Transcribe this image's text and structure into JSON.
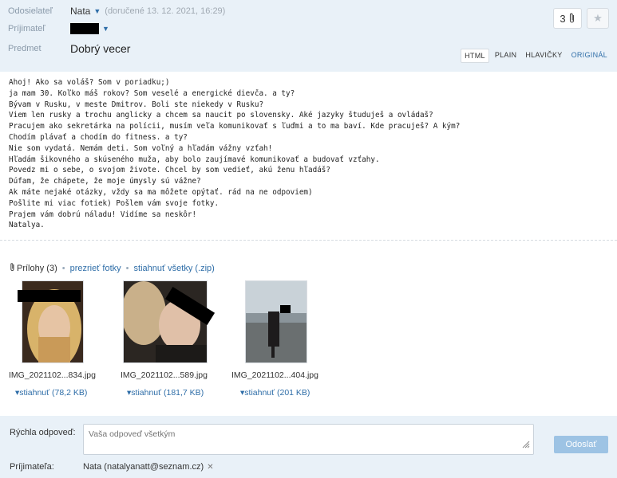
{
  "header": {
    "sender_label": "Odosielateľ",
    "sender_name": "Nata",
    "delivered": "(doručené 13. 12. 2021, 16:29)",
    "recipient_label": "Príjimateľ",
    "subject_label": "Predmet",
    "subject": "Dobrý vecer",
    "attachment_count": "3",
    "view_tabs": [
      "HTML",
      "PLAIN",
      "HLAVIČKY",
      "ORIGINÁL"
    ]
  },
  "message": {
    "body": "Ahoj! Ako sa voláš? Som v poriadku;)\nja mam 30. Koľko máš rokov? Som veselé a energické dievča. a ty?\nBývam v Rusku, v meste Dmitrov. Boli ste niekedy v Rusku?\nViem len rusky a trochu anglicky a chcem sa naucit po slovensky. Aké jazyky študuješ a ovládaš?\nPracujem ako sekretárka na polícii, musím veľa komunikovať s ľuďmi a to ma baví. Kde pracuješ? A kým?\nChodím plávať a chodím do fitness. a ty?\nNie som vydatá. Nemám deti. Som voľný a hľadám vážny vzťah!\nHľadám šikovného a skúseného muža, aby bolo zaujímavé komunikovať a budovať vzťahy.\nPovedz mi o sebe, o svojom živote. Chcel by som vedieť, akú ženu hľadáš?\nDúfam, že chápete, že moje úmysly sú vážne?\nAk máte nejaké otázky, vždy sa ma môžete opýtať. rád na ne odpoviem)\nPošlite mi viac fotiek) Pošlem vám svoje fotky.\nPrajem vám dobrú náladu! Vidíme sa neskôr!\nNatalya."
  },
  "attachments": {
    "label": "Prílohy (3)",
    "view_photos": "prezrieť fotky",
    "download_all": "stiahnuť všetky (.zip)",
    "items": [
      {
        "filename": "IMG_2021102...834.jpg",
        "download": "stiahnuť (78,2 KB)"
      },
      {
        "filename": "IMG_2021102...589.jpg",
        "download": "stiahnuť (181,7 KB)"
      },
      {
        "filename": "IMG_2021102...404.jpg",
        "download": "stiahnuť (201 KB)"
      }
    ]
  },
  "reply": {
    "label": "Rýchla odpoveď:",
    "placeholder": "Vaša odpoveď všetkým",
    "send": "Odoslať",
    "recipients_label": "Príjimateľa:",
    "recipient": "Nata (natalyanatt@seznam.cz)"
  },
  "colors": {
    "header_bg": "#e9f1f8",
    "link": "#2f6ea8",
    "send_button": "#9dc3e4"
  }
}
